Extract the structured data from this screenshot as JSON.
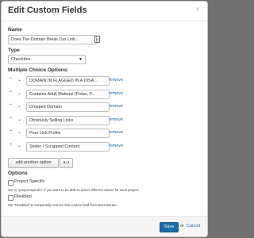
{
  "dialog": {
    "title": "Edit Custom Fields",
    "close": "×"
  },
  "name": {
    "label": "Name",
    "value": "Does The Domain Break Our Link...",
    "icon": "card-icon"
  },
  "type": {
    "label": "Type",
    "selected": "Checkbox"
  },
  "options": {
    "label": "Multiple Choice Options:",
    "remove_label": "remove",
    "items": [
      "DOMAIN IN FLAGGED IN A DISA...",
      "Contains Adult Material (Poker, P...",
      "Dropped Domain",
      "Obviously Selling Links",
      "Poor Link Profile",
      "Stolen / Scrapped Content"
    ]
  },
  "buttons": {
    "add_option": "add another option",
    "sort_az": "a↓z"
  },
  "settings": {
    "label": "Options",
    "project_specific": {
      "label": "Project Specific",
      "help": "Set to \"project-specific\" if you want to be able to select different values for each project.",
      "checked": false
    },
    "disabled": {
      "label": "Disabled",
      "help": "Set \"Disabled\" to temporarily remove this custom field from BuzzStream.",
      "checked": false
    }
  },
  "footer": {
    "save": "Save",
    "or": "or",
    "cancel": "Cancel"
  },
  "colors": {
    "accent": "#1c6ca3",
    "link": "#1a5fa8"
  }
}
